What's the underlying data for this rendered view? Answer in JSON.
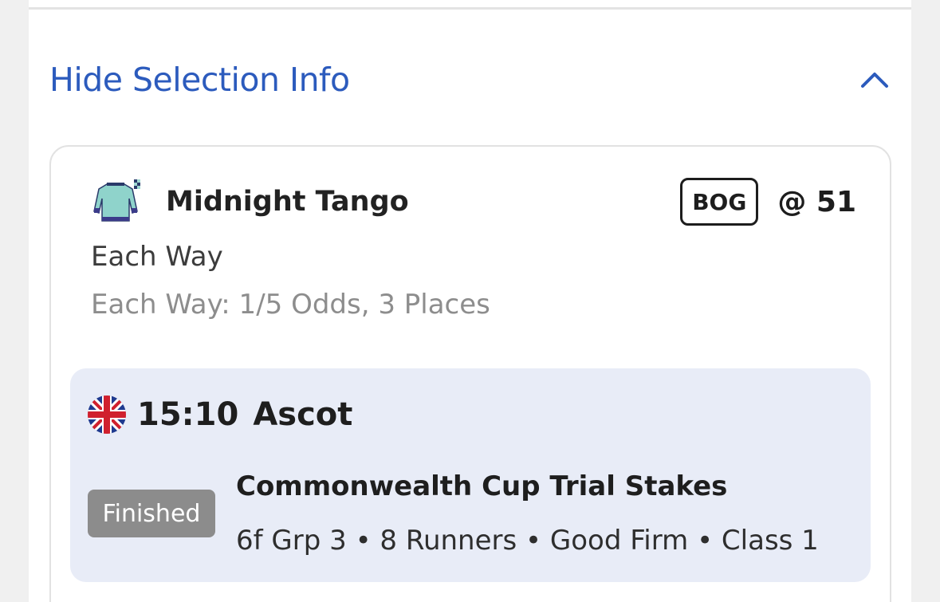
{
  "selection_info": {
    "toggle_label": "Hide Selection Info",
    "toggle_icon": "chevron-up-icon",
    "accent_color": "#2c5bbd"
  },
  "selection": {
    "silks_icon": "jockey-silks-icon",
    "runner_name": "Midnight Tango",
    "badge": "BOG",
    "odds": "@ 51",
    "bet_type": "Each Way",
    "each_way_terms": "Each Way: 1/5 Odds, 3 Places"
  },
  "event": {
    "flag_icon": "uk-flag-icon",
    "time": "15:10",
    "venue": "Ascot",
    "status": "Finished",
    "race_name": "Commonwealth Cup Trial Stakes",
    "details": "6f Grp 3 • 8 Runners • Good Firm • Class 1",
    "panel_color": "#e8ecf7",
    "status_color": "#8c8c8c"
  }
}
